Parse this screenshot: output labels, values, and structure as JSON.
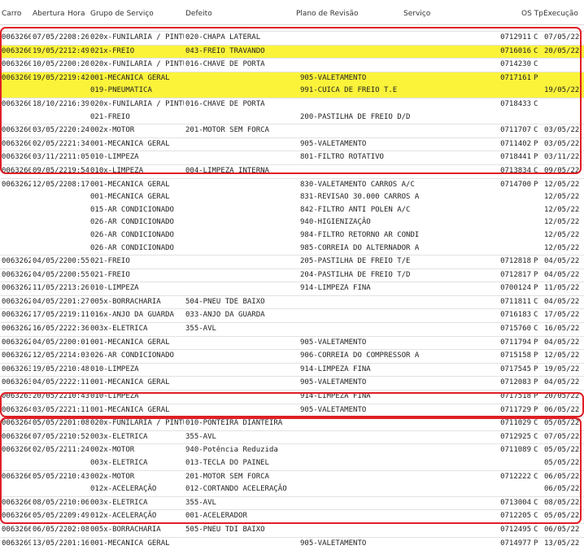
{
  "header": {
    "carro": "Carro",
    "abertura": "Abertura",
    "hora": "Hora",
    "grupo": "Grupo de Serviço",
    "defeito": "Defeito",
    "plano": "Plano de Revisão",
    "servico": "Serviço",
    "os_tp": "OS Tp",
    "execucao": "Execução"
  },
  "colors": {
    "highlight": "#fbf33a",
    "frame": "#e01f26"
  },
  "rows": [
    {
      "carro": "0063260",
      "abertura": "07/05/22",
      "hora": "08:26",
      "grupo": "020x-FUNILARIA / PINTURA",
      "defeito": "020-CHAPA LATERAL",
      "plano": "",
      "os": "0712911",
      "tp": "C",
      "exec": "07/05/22",
      "hl": false
    },
    {
      "carro": "0063260",
      "abertura": "19/05/22",
      "hora": "12:49",
      "grupo": "021x-FREIO",
      "defeito": "043-FREIO TRAVANDO",
      "plano": "",
      "os": "0716016",
      "tp": "C",
      "exec": "20/05/22",
      "hl": true
    },
    {
      "carro": "0063260",
      "abertura": "10/05/22",
      "hora": "00:20",
      "grupo": "020x-FUNILARIA / PINTURA",
      "defeito": "016-CHAVE DE PORTA",
      "plano": "",
      "os": "0714230",
      "tp": "C",
      "exec": "",
      "hl": false
    },
    {
      "carro": "0063260",
      "abertura": "19/05/22",
      "hora": "19:42",
      "grupo": "001-MECANICA GERAL",
      "defeito": "",
      "plano": "905-VALETAMENTO",
      "os": "0717161",
      "tp": "P",
      "exec": "",
      "hl": true
    },
    {
      "carro": "",
      "abertura": "",
      "hora": "",
      "grupo": "019-PNEUMATICA",
      "defeito": "",
      "plano": "991-CUICA DE FREIO T.E",
      "os": "",
      "tp": "",
      "exec": "19/05/22",
      "hl": true
    },
    {
      "carro": "0063260",
      "abertura": "18/10/22",
      "hora": "16:39",
      "grupo": "020x-FUNILARIA / PINTURA",
      "defeito": "016-CHAVE DE PORTA",
      "plano": "",
      "os": "0718433",
      "tp": "C",
      "exec": "",
      "hl": false
    },
    {
      "carro": "",
      "abertura": "",
      "hora": "",
      "grupo": "021-FREIO",
      "defeito": "",
      "plano": "200-PASTILHA DE FREIO D/D",
      "os": "",
      "tp": "",
      "exec": "",
      "hl": false
    },
    {
      "carro": "0063260",
      "abertura": "03/05/22",
      "hora": "20:24",
      "grupo": "002x-MOTOR",
      "defeito": "201-MOTOR SEM FORCA",
      "plano": "",
      "os": "0711707",
      "tp": "C",
      "exec": "03/05/22",
      "hl": false
    },
    {
      "carro": "0063260",
      "abertura": "02/05/22",
      "hora": "21:34",
      "grupo": "001-MECANICA GERAL",
      "defeito": "",
      "plano": "905-VALETAMENTO",
      "os": "0711402",
      "tp": "P",
      "exec": "03/05/22",
      "hl": false
    },
    {
      "carro": "0063260",
      "abertura": "03/11/22",
      "hora": "11:05",
      "grupo": "010-LIMPEZA",
      "defeito": "",
      "plano": "801-FILTRO ROTATIVO",
      "os": "0718441",
      "tp": "P",
      "exec": "03/11/22",
      "hl": false
    },
    {
      "carro": "0063260",
      "abertura": "09/05/22",
      "hora": "19:54",
      "grupo": "010x-LIMPEZA",
      "defeito": "004-LIMPEZA INTERNA",
      "plano": "",
      "os": "0713834",
      "tp": "C",
      "exec": "09/05/22",
      "hl": false
    },
    {
      "carro": "0063262",
      "abertura": "12/05/22",
      "hora": "08:17",
      "grupo": "001-MECANICA GERAL",
      "defeito": "",
      "plano": "830-VALETAMENTO CARROS A/C",
      "os": "0714700",
      "tp": "P",
      "exec": "12/05/22",
      "hl": false
    },
    {
      "carro": "",
      "abertura": "",
      "hora": "",
      "grupo": "001-MECANICA GERAL",
      "defeito": "",
      "plano": "831-REVISAO 30.000 CARROS A",
      "os": "",
      "tp": "",
      "exec": "12/05/22",
      "hl": false
    },
    {
      "carro": "",
      "abertura": "",
      "hora": "",
      "grupo": "015-AR CONDICIONADO",
      "defeito": "",
      "plano": "842-FILTRO ANTI POLEN A/C",
      "os": "",
      "tp": "",
      "exec": "12/05/22",
      "hl": false
    },
    {
      "carro": "",
      "abertura": "",
      "hora": "",
      "grupo": "026-AR CONDICIONADO",
      "defeito": "",
      "plano": "940-HIGIENIZAÇÃO",
      "os": "",
      "tp": "",
      "exec": "12/05/22",
      "hl": false
    },
    {
      "carro": "",
      "abertura": "",
      "hora": "",
      "grupo": "026-AR CONDICIONADO",
      "defeito": "",
      "plano": "984-FILTRO RETORNO AR CONDI",
      "os": "",
      "tp": "",
      "exec": "12/05/22",
      "hl": false
    },
    {
      "carro": "",
      "abertura": "",
      "hora": "",
      "grupo": "026-AR CONDICIONADO",
      "defeito": "",
      "plano": "985-CORREIA DO ALTERNADOR A",
      "os": "",
      "tp": "",
      "exec": "12/05/22",
      "hl": false
    },
    {
      "carro": "0063262",
      "abertura": "04/05/22",
      "hora": "00:55",
      "grupo": "021-FREIO",
      "defeito": "",
      "plano": "205-PASTILHA DE FREIO T/E",
      "os": "0712818",
      "tp": "P",
      "exec": "04/05/22",
      "hl": false
    },
    {
      "carro": "0063262",
      "abertura": "04/05/22",
      "hora": "00:55",
      "grupo": "021-FREIO",
      "defeito": "",
      "plano": "204-PASTILHA DE FREIO T/D",
      "os": "0712817",
      "tp": "P",
      "exec": "04/05/22",
      "hl": false
    },
    {
      "carro": "0063262",
      "abertura": "11/05/22",
      "hora": "13:26",
      "grupo": "010-LIMPEZA",
      "defeito": "",
      "plano": "914-LIMPEZA FINA",
      "os": "0700124",
      "tp": "P",
      "exec": "11/05/22",
      "hl": false
    },
    {
      "carro": "0063262",
      "abertura": "04/05/22",
      "hora": "01:27",
      "grupo": "005x-BORRACHARIA",
      "defeito": "504-PNEU TDE BAIXO",
      "plano": "",
      "os": "0711811",
      "tp": "C",
      "exec": "04/05/22",
      "hl": false
    },
    {
      "carro": "0063262",
      "abertura": "17/05/22",
      "hora": "19:11",
      "grupo": "016x-ANJO DA GUARDA",
      "defeito": "033-ANJO DA GUARDA",
      "plano": "",
      "os": "0716183",
      "tp": "C",
      "exec": "17/05/22",
      "hl": false
    },
    {
      "carro": "0063262",
      "abertura": "16/05/22",
      "hora": "22:36",
      "grupo": "003x-ELETRICA",
      "defeito": "355-AVL",
      "plano": "",
      "os": "0715760",
      "tp": "C",
      "exec": "16/05/22",
      "hl": false
    },
    {
      "carro": "0063262",
      "abertura": "04/05/22",
      "hora": "00:01",
      "grupo": "001-MECANICA GERAL",
      "defeito": "",
      "plano": "905-VALETAMENTO",
      "os": "0711794",
      "tp": "P",
      "exec": "04/05/22",
      "hl": false
    },
    {
      "carro": "0063262",
      "abertura": "12/05/22",
      "hora": "14:03",
      "grupo": "026-AR CONDICIONADO",
      "defeito": "",
      "plano": "906-CORREIA DO COMPRESSOR A",
      "os": "0715158",
      "tp": "P",
      "exec": "12/05/22",
      "hl": false
    },
    {
      "carro": "0063263",
      "abertura": "19/05/22",
      "hora": "10:48",
      "grupo": "010-LIMPEZA",
      "defeito": "",
      "plano": "914-LIMPEZA FINA",
      "os": "0717545",
      "tp": "P",
      "exec": "19/05/22",
      "hl": false
    },
    {
      "carro": "0063263",
      "abertura": "04/05/22",
      "hora": "22:11",
      "grupo": "001-MECANICA GERAL",
      "defeito": "",
      "plano": "905-VALETAMENTO",
      "os": "0712083",
      "tp": "P",
      "exec": "04/05/22",
      "hl": false
    },
    {
      "carro": "0063263",
      "abertura": "20/05/22",
      "hora": "10:43",
      "grupo": "010-LIMPEZA",
      "defeito": "",
      "plano": "914-LIMPEZA FINA",
      "os": "0717518",
      "tp": "P",
      "exec": "20/05/22",
      "hl": false
    },
    {
      "carro": "0063264",
      "abertura": "03/05/22",
      "hora": "21:11",
      "grupo": "001-MECANICA GERAL",
      "defeito": "",
      "plano": "905-VALETAMENTO",
      "os": "0711729",
      "tp": "P",
      "exec": "06/05/22",
      "hl": false
    },
    {
      "carro": "0063264",
      "abertura": "05/05/22",
      "hora": "01:08",
      "grupo": "020x-FUNILARIA / PINTURA",
      "defeito": "010-PONTEIRA DIANTEIRA",
      "plano": "",
      "os": "0711029",
      "tp": "C",
      "exec": "05/05/22",
      "hl": false
    },
    {
      "carro": "0063266",
      "abertura": "07/05/22",
      "hora": "10:52",
      "grupo": "003x-ELETRICA",
      "defeito": "355-AVL",
      "plano": "",
      "os": "0712925",
      "tp": "C",
      "exec": "07/05/22",
      "hl": false
    },
    {
      "carro": "0063266",
      "abertura": "02/05/22",
      "hora": "11:24",
      "grupo": "002x-MOTOR",
      "defeito": "940-Potência Reduzida",
      "plano": "",
      "os": "0711089",
      "tp": "C",
      "exec": "05/05/22",
      "hl": false
    },
    {
      "carro": "",
      "abertura": "",
      "hora": "",
      "grupo": "003x-ELETRICA",
      "defeito": "013-TECLA DO PAINEL",
      "plano": "",
      "os": "",
      "tp": "",
      "exec": "05/05/22",
      "hl": false
    },
    {
      "carro": "0063266",
      "abertura": "05/05/22",
      "hora": "10:43",
      "grupo": "002x-MOTOR",
      "defeito": "201-MOTOR SEM FORCA",
      "plano": "",
      "os": "0712222",
      "tp": "C",
      "exec": "06/05/22",
      "hl": false
    },
    {
      "carro": "",
      "abertura": "",
      "hora": "",
      "grupo": "012x-ACELERAÇÃO",
      "defeito": "012-CORTANDO ACELERAÇÃO",
      "plano": "",
      "os": "",
      "tp": "",
      "exec": "06/05/22",
      "hl": false
    },
    {
      "carro": "0063266",
      "abertura": "08/05/22",
      "hora": "10:06",
      "grupo": "003x-ELETRICA",
      "defeito": "355-AVL",
      "plano": "",
      "os": "0713004",
      "tp": "C",
      "exec": "08/05/22",
      "hl": false
    },
    {
      "carro": "0063266",
      "abertura": "05/05/22",
      "hora": "09:49",
      "grupo": "012x-ACELERAÇÃO",
      "defeito": "001-ACELERADOR",
      "plano": "",
      "os": "0712205",
      "tp": "C",
      "exec": "05/05/22",
      "hl": false
    },
    {
      "carro": "0063266",
      "abertura": "06/05/22",
      "hora": "02:08",
      "grupo": "005x-BORRACHARIA",
      "defeito": "505-PNEU TDI BAIXO",
      "plano": "",
      "os": "0712495",
      "tp": "C",
      "exec": "06/05/22",
      "hl": false
    },
    {
      "carro": "0063269",
      "abertura": "13/05/22",
      "hora": "01:16",
      "grupo": "001-MECANICA GERAL",
      "defeito": "",
      "plano": "905-VALETAMENTO",
      "os": "0714977",
      "tp": "P",
      "exec": "13/05/22",
      "hl": false
    }
  ]
}
